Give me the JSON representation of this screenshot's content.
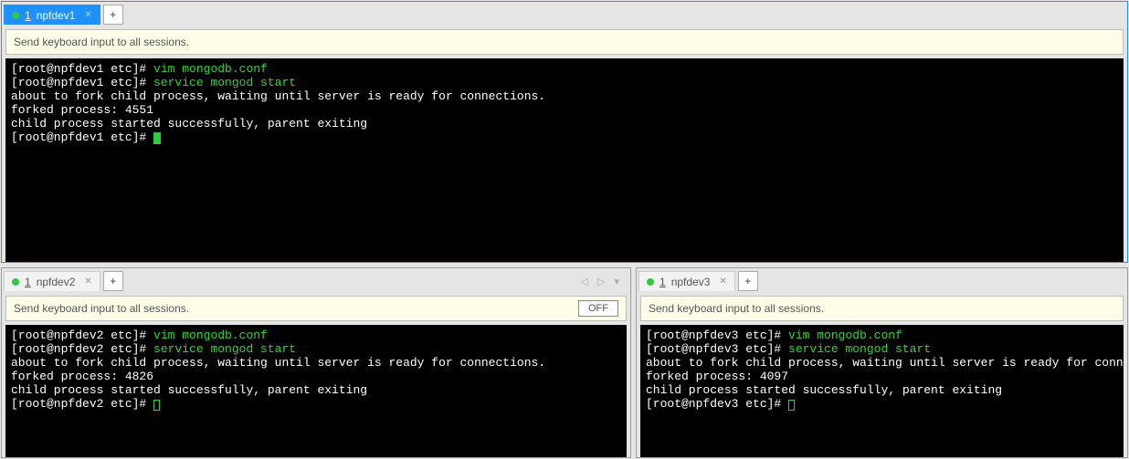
{
  "pane1": {
    "tab": {
      "num": "1",
      "name": "npfdev1"
    },
    "placeholder": "Send keyboard input to all sessions.",
    "lines": {
      "l1a": "[root@npfdev1 etc]# ",
      "l1b": "vim mongodb.conf",
      "l2a": "[root@npfdev1 etc]# ",
      "l2b": "service mongod start",
      "l3": "about to fork child process, waiting until server is ready for connections.",
      "l4": "forked process: 4551",
      "l5": "child process started successfully, parent exiting",
      "l6": "[root@npfdev1 etc]# "
    }
  },
  "pane2": {
    "tab": {
      "num": "1",
      "name": "npfdev2"
    },
    "placeholder": "Send keyboard input to all sessions.",
    "off": "OFF",
    "lines": {
      "l1a": "[root@npfdev2 etc]# ",
      "l1b": "vim mongodb.conf",
      "l2a": "[root@npfdev2 etc]# ",
      "l2b": "service mongod start",
      "l3": "about to fork child process, waiting until server is ready for connections.",
      "l4": "forked process: 4826",
      "l5": "child process started successfully, parent exiting",
      "l6": "[root@npfdev2 etc]# "
    }
  },
  "pane3": {
    "tab": {
      "num": "1",
      "name": "npfdev3"
    },
    "placeholder": "Send keyboard input to all sessions.",
    "lines": {
      "l1a": "[root@npfdev3 etc]# ",
      "l1b": "vim mongodb.conf",
      "l2a": "[root@npfdev3 etc]# ",
      "l2b": "service mongod start",
      "l3": "about to fork child process, waiting until server is ready for connections.",
      "l4": "forked process: 4097",
      "l5": "child process started successfully, parent exiting",
      "l6": "[root@npfdev3 etc]# "
    }
  }
}
